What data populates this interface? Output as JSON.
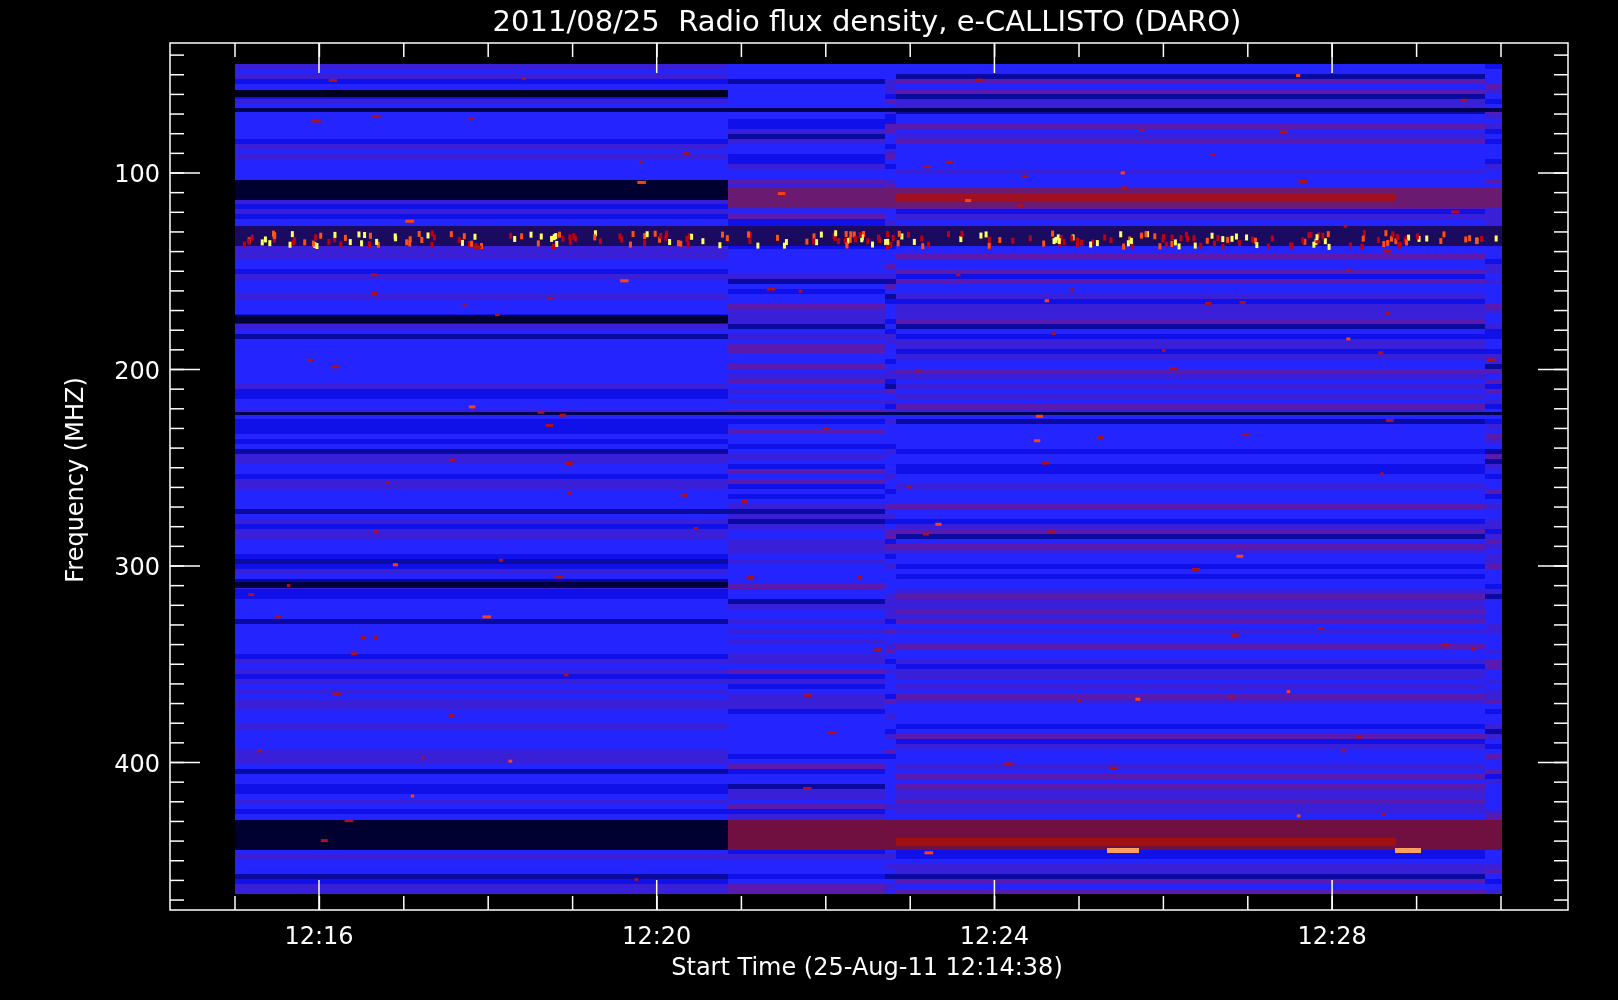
{
  "title": "2011/08/25  Radio flux density, e-CALLISTO (DARO)",
  "y_axis": {
    "label": "Frequency (MHZ)",
    "ticks": [
      "100",
      "200",
      "300",
      "400"
    ]
  },
  "x_axis": {
    "label": "Start Time (25-Aug-11 12:14:38)",
    "ticks": [
      "12:16",
      "12:20",
      "12:24",
      "12:28"
    ]
  }
}
